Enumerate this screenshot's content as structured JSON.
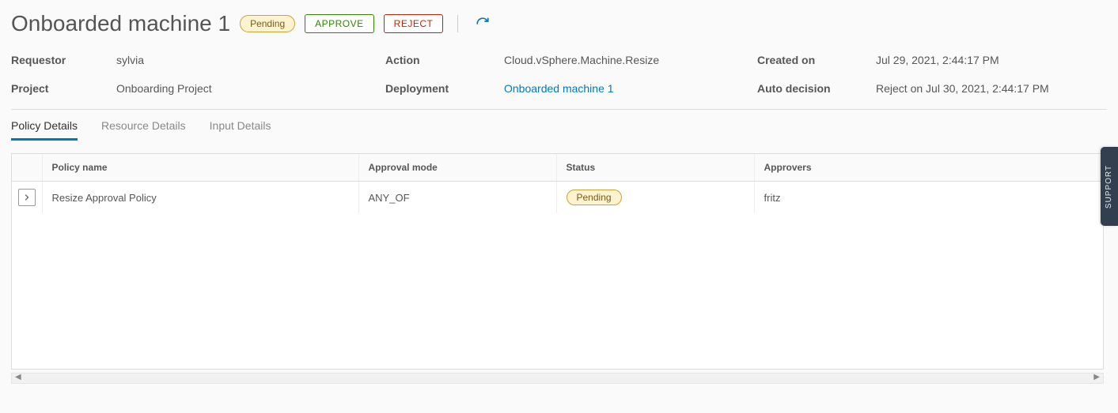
{
  "header": {
    "title": "Onboarded machine 1",
    "status": "Pending",
    "approve_label": "APPROVE",
    "reject_label": "REJECT"
  },
  "meta": {
    "requestor_label": "Requestor",
    "requestor_value": "sylvia",
    "action_label": "Action",
    "action_value": "Cloud.vSphere.Machine.Resize",
    "created_label": "Created on",
    "created_value": "Jul 29, 2021, 2:44:17 PM",
    "project_label": "Project",
    "project_value": "Onboarding Project",
    "deployment_label": "Deployment",
    "deployment_value": "Onboarded machine 1",
    "auto_label": "Auto decision",
    "auto_value": "Reject on Jul 30, 2021, 2:44:17 PM"
  },
  "tabs": {
    "policy": "Policy Details",
    "resource": "Resource Details",
    "input": "Input Details"
  },
  "table": {
    "headers": {
      "name": "Policy name",
      "mode": "Approval mode",
      "status": "Status",
      "approvers": "Approvers"
    },
    "rows": [
      {
        "name": "Resize Approval Policy",
        "mode": "ANY_OF",
        "status": "Pending",
        "approvers": "fritz"
      }
    ]
  },
  "support_label": "SUPPORT"
}
